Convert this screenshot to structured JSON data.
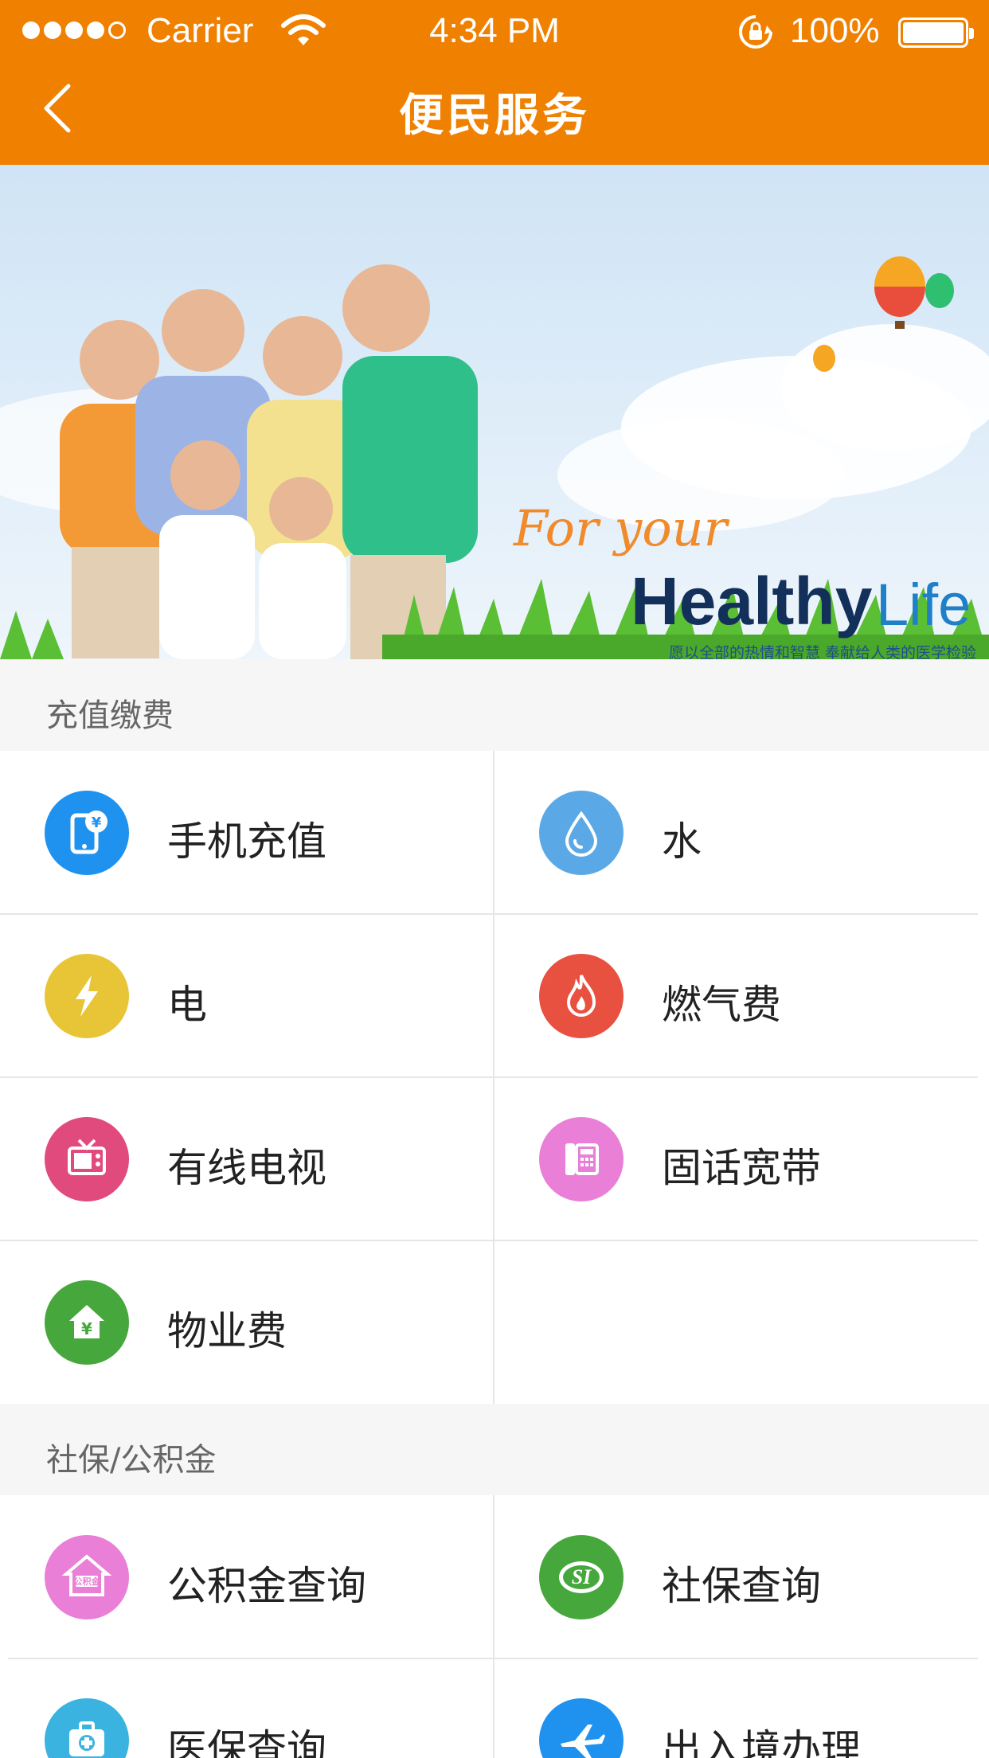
{
  "status_bar": {
    "carrier": "Carrier",
    "time": "4:34 PM",
    "battery": "100%"
  },
  "nav": {
    "title": "便民服务"
  },
  "banner": {
    "line1": "For your",
    "line2": "Healthy",
    "line3": "Life",
    "slogan": "愿以全部的热情和智慧 奉献给人类的医学检验事业"
  },
  "sections": [
    {
      "title": "充值缴费",
      "items": [
        {
          "label": "手机充值",
          "icon": "phone-recharge-icon",
          "color": "#1f92f0"
        },
        {
          "label": "水",
          "icon": "water-drop-icon",
          "color": "#5aa9e6"
        },
        {
          "label": "电",
          "icon": "lightning-icon",
          "color": "#e8c536"
        },
        {
          "label": "燃气费",
          "icon": "flame-icon",
          "color": "#e85040"
        },
        {
          "label": "有线电视",
          "icon": "tv-icon",
          "color": "#e04a7d"
        },
        {
          "label": "固话宽带",
          "icon": "telephone-icon",
          "color": "#e97fd6"
        },
        {
          "label": "物业费",
          "icon": "house-yen-icon",
          "color": "#46a83c"
        }
      ]
    },
    {
      "title": "社保/公积金",
      "items": [
        {
          "label": "公积金查询",
          "icon": "housing-fund-icon",
          "color": "#e97fd6",
          "icon_text": "公积金"
        },
        {
          "label": "社保查询",
          "icon": "social-security-icon",
          "color": "#46a83c",
          "icon_text": "SI"
        },
        {
          "label": "医保查询",
          "icon": "medical-kit-icon",
          "color": "#3bb3e0"
        },
        {
          "label": "出入境办理",
          "icon": "airplane-icon",
          "color": "#1f92f0"
        }
      ]
    }
  ]
}
